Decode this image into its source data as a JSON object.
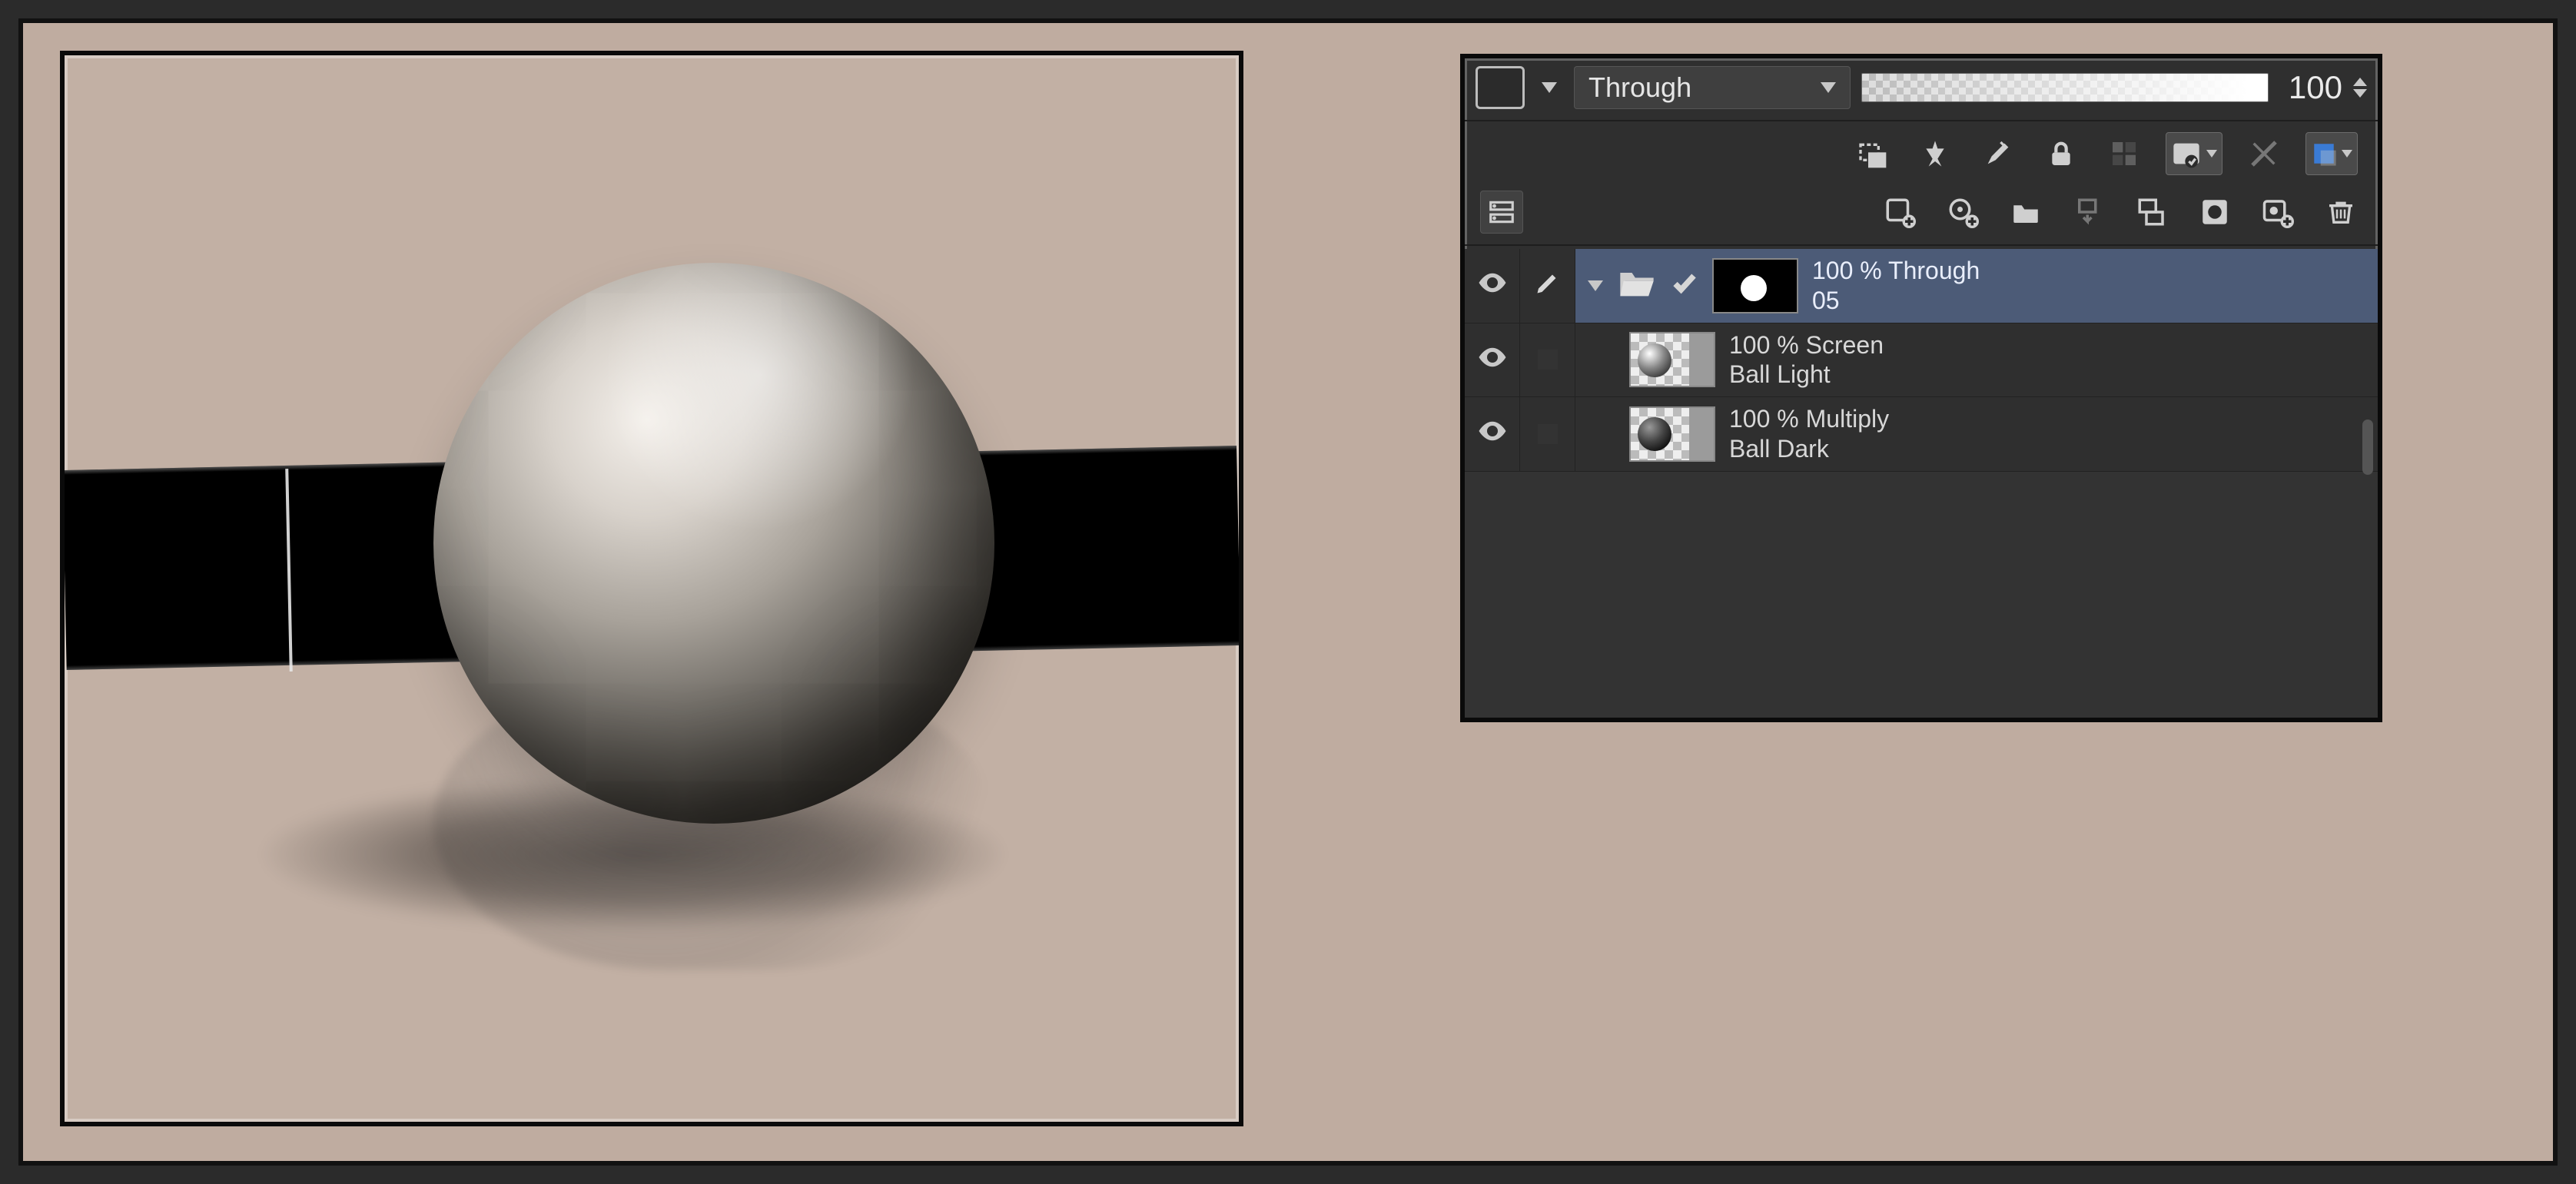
{
  "header": {
    "blend_mode": "Through",
    "opacity_value": "100"
  },
  "layers": [
    {
      "id": "folder05",
      "info": "100 % Through",
      "name": "05",
      "type": "folder",
      "selected": true,
      "expanded": true,
      "has_mask": true
    },
    {
      "id": "ball_light",
      "info": "100 % Screen",
      "name": "Ball Light",
      "type": "raster",
      "thumb_style": "checker-light",
      "child": true
    },
    {
      "id": "ball_dark",
      "info": "100 % Multiply",
      "name": "Ball Dark",
      "type": "raster",
      "thumb_style": "checker-dark",
      "child": true
    }
  ]
}
